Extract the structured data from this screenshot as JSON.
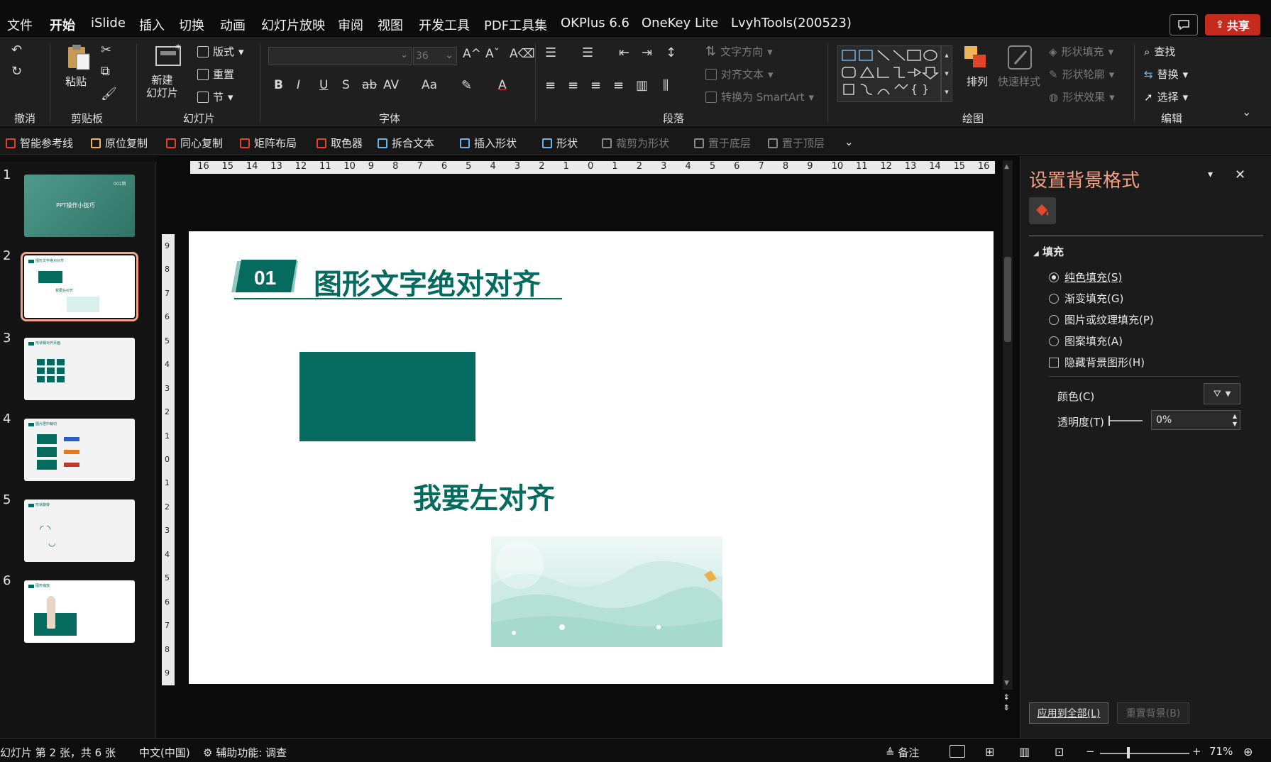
{
  "menu": [
    "文件",
    "开始",
    "iSlide",
    "插入",
    "切换",
    "动画",
    "幻灯片放映",
    "审阅",
    "视图",
    "开发工具",
    "PDF工具集",
    "OKPlus 6.6",
    "OneKey Lite",
    "LvyhTools(200523)"
  ],
  "share_label": "共享",
  "ribbon": {
    "groups": {
      "undo": "撤消",
      "clipboard": "剪贴板",
      "slides": "幻灯片",
      "font": "字体",
      "paragraph": "段落",
      "drawing": "绘图",
      "editing": "编辑"
    },
    "paste": "粘贴",
    "new_slide": "新建\n幻灯片",
    "layout": "版式",
    "reset": "重置",
    "section": "节",
    "font_size": "36",
    "text_direction": "文字方向",
    "align_text": "对齐文本",
    "convert_smartart": "转换为 SmartArt",
    "arrange": "排列",
    "quick_styles": "快速样式",
    "shape_fill": "形状填充",
    "shape_outline": "形状轮廓",
    "shape_effects": "形状效果",
    "find": "查找",
    "replace": "替换",
    "select": "选择"
  },
  "qat": [
    {
      "label": "智能参考线",
      "color": "#e0452b",
      "dim": false
    },
    {
      "label": "原位复制",
      "color": "#f0b45a",
      "dim": false
    },
    {
      "label": "同心复制",
      "color": "#e0452b",
      "dim": false
    },
    {
      "label": "矩阵布局",
      "color": "#e0452b",
      "dim": false
    },
    {
      "label": "取色器",
      "color": "#e0452b",
      "dim": false
    },
    {
      "label": "拆合文本",
      "color": "#6fb2e8",
      "dim": false
    },
    {
      "label": "插入形状",
      "color": "#6fb2e8",
      "dim": false
    },
    {
      "label": "形状",
      "color": "#6fb2e8",
      "dim": false
    },
    {
      "label": "裁剪为形状",
      "color": "#888888",
      "dim": true
    },
    {
      "label": "置于底层",
      "color": "#888888",
      "dim": true
    },
    {
      "label": "置于顶层",
      "color": "#888888",
      "dim": true
    }
  ],
  "thumbnails": [
    {
      "num": "1",
      "title": "PPT操作小技巧",
      "tag": "001期"
    },
    {
      "num": "2",
      "title": "图形文字绝对对齐",
      "sub": "我要左对齐"
    },
    {
      "num": "3",
      "title": "形状相对齐页面"
    },
    {
      "num": "4",
      "title": "图片居中裁切"
    },
    {
      "num": "5",
      "title": "形状旋转"
    },
    {
      "num": "6",
      "title": "图形缩放"
    }
  ],
  "slide": {
    "number": "01",
    "title": "图形文字绝对对齐",
    "body_text": "我要左对齐",
    "accent": "#046b5e"
  },
  "ruler_ticks": [
    "16",
    "15",
    "14",
    "13",
    "12",
    "11",
    "10",
    "9",
    "8",
    "7",
    "6",
    "5",
    "4",
    "3",
    "2",
    "1",
    "0",
    "1",
    "2",
    "3",
    "4",
    "5",
    "6",
    "7",
    "8",
    "9",
    "10",
    "11",
    "12",
    "13",
    "14",
    "15",
    "16"
  ],
  "vruler_ticks": [
    "9",
    "8",
    "7",
    "6",
    "5",
    "4",
    "3",
    "2",
    "1",
    "0",
    "1",
    "2",
    "3",
    "4",
    "5",
    "6",
    "7",
    "8",
    "9"
  ],
  "pane": {
    "title": "设置背景格式",
    "section": "填充",
    "options": [
      {
        "label": "纯色填充(S)",
        "checked": true
      },
      {
        "label": "渐变填充(G)",
        "checked": false
      },
      {
        "label": "图片或纹理填充(P)",
        "checked": false
      },
      {
        "label": "图案填充(A)",
        "checked": false
      }
    ],
    "hide_bg": "隐藏背景图形(H)",
    "color_label": "颜色(C)",
    "transparency_label": "透明度(T)",
    "transparency_value": "0%",
    "apply_all": "应用到全部(L)",
    "reset_bg": "重置背景(B)"
  },
  "status": {
    "slide_info": "幻灯片 第 2 张，共 6 张",
    "language": "中文(中国)",
    "accessibility": "辅助功能: 调查",
    "notes": "备注",
    "zoom": "71%"
  }
}
